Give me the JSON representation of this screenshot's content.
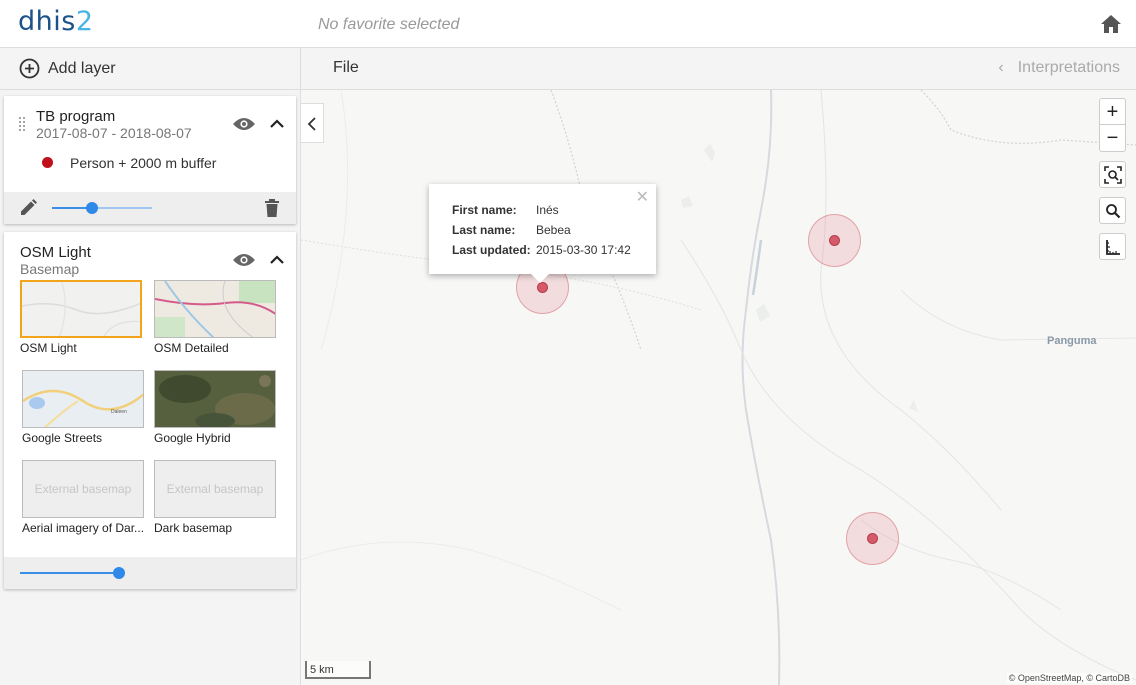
{
  "header": {
    "logo_main": "dhis",
    "logo_num": "2",
    "favorite": "No favorite selected"
  },
  "toolbar": {
    "add_layer": "Add layer",
    "file": "File",
    "interpretations": "Interpretations"
  },
  "layers": [
    {
      "title": "TB program",
      "subtitle": "2017-08-07 - 2018-08-07",
      "legend": "Person + 2000 m buffer",
      "legend_color": "#c0101c",
      "opacity": 0.4
    },
    {
      "title": "OSM Light",
      "subtitle": "Basemap",
      "opacity": 0.8,
      "basemaps": [
        {
          "label": "OSM Light",
          "selected": true
        },
        {
          "label": "OSM Detailed",
          "selected": false
        },
        {
          "label": "Google Streets",
          "selected": false
        },
        {
          "label": "Google Hybrid",
          "selected": false
        },
        {
          "label": "Aerial imagery of Dar...",
          "selected": false,
          "placeholder": "External basemap"
        },
        {
          "label": "Dark basemap",
          "selected": false,
          "placeholder": "External basemap"
        }
      ]
    }
  ],
  "map": {
    "popup": {
      "first_name_label": "First name:",
      "first_name": "Inés",
      "last_name_label": "Last name:",
      "last_name": "Bebea",
      "updated_label": "Last updated:",
      "updated": "2015-03-30 17:42"
    },
    "place_label": "Panguma",
    "scale_label": "5 km",
    "attribution": "© OpenStreetMap, © CartoDB",
    "zoom_in": "+",
    "zoom_out": "−"
  },
  "colors": {
    "accent": "#2f89e8",
    "selected_border": "#f2a51b",
    "point": "#d65a6a"
  }
}
